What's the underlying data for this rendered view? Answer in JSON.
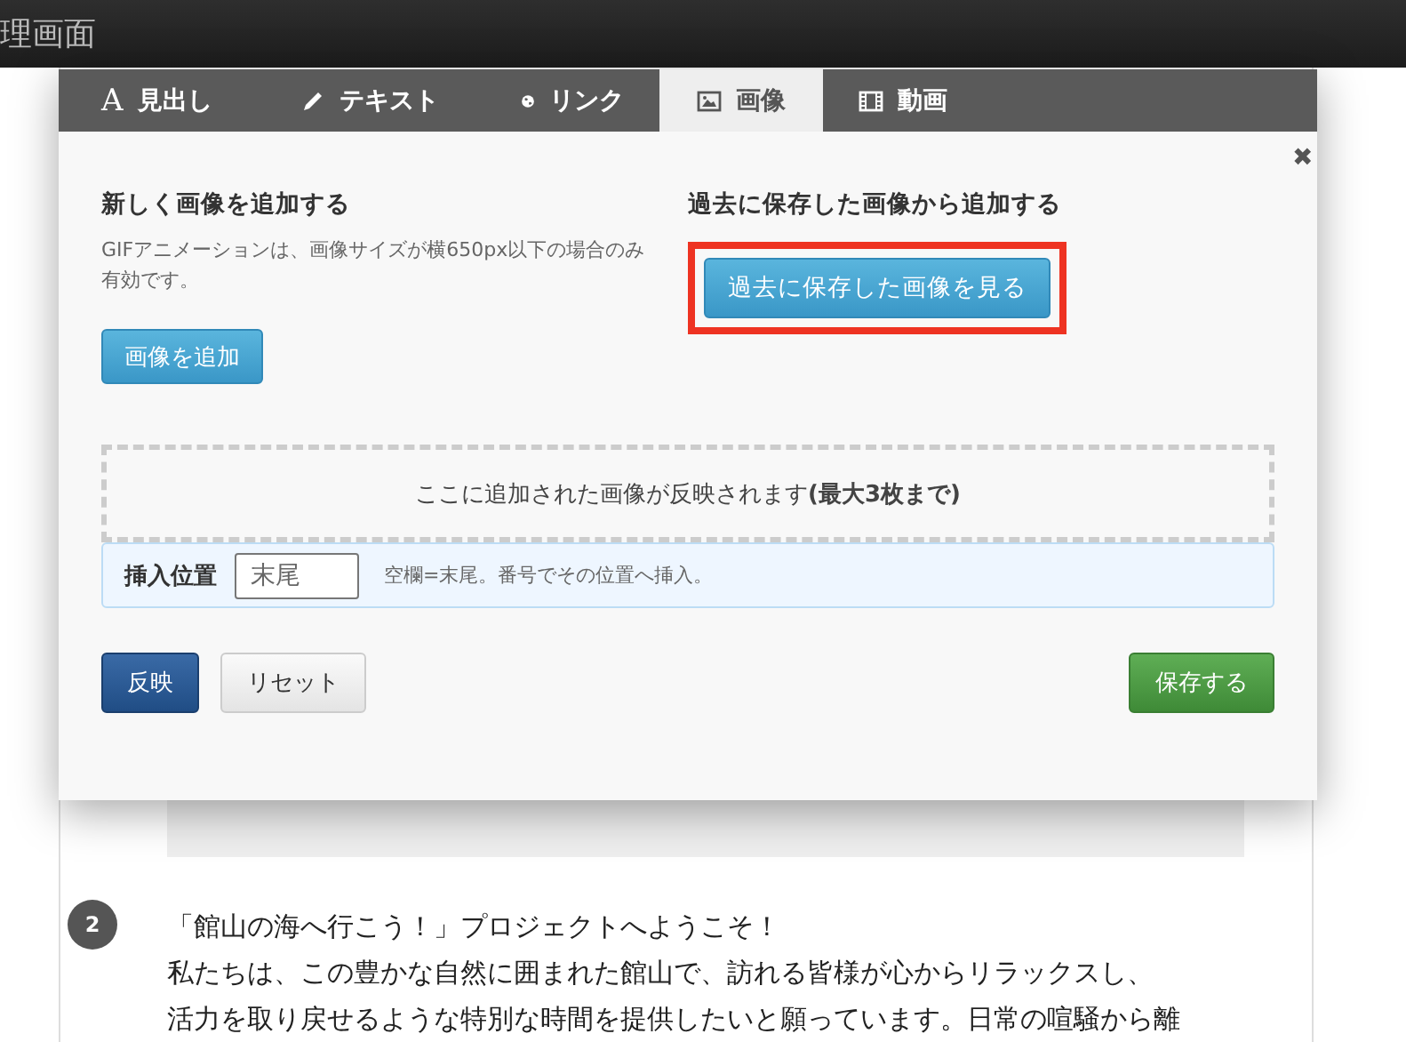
{
  "top_bar": {
    "title": "理画面"
  },
  "dialog": {
    "tabs": [
      {
        "label": "見出し",
        "kind": "letter",
        "glyph": "A",
        "selected": false
      },
      {
        "label": "テキスト",
        "kind": "pencil",
        "selected": false
      },
      {
        "label": "リンク",
        "kind": "globe",
        "selected": false
      },
      {
        "label": "画像",
        "kind": "picture",
        "selected": true
      },
      {
        "label": "動画",
        "kind": "film",
        "selected": false
      }
    ],
    "close": "✖",
    "new_image": {
      "heading": "新しく画像を追加する",
      "note": "GIFアニメーションは、画像サイズが横650px以下の場合のみ有効です。",
      "button": "画像を追加"
    },
    "saved_image": {
      "heading": "過去に保存した画像から追加する",
      "button": "過去に保存した画像を見る",
      "highlighted": true
    },
    "drop_area": {
      "text": "ここに追加された画像が反映されます**(最大3枚まで)**"
    },
    "insert_position": {
      "label": "挿入位置",
      "placeholder": "末尾",
      "hint": "空欄=末尾。番号でその位置へ挿入。"
    },
    "buttons": {
      "apply": "反映",
      "reset": "リセット",
      "save": "保存する"
    }
  },
  "page": {
    "step": "2",
    "paragraph_lines": [
      "「館山の海へ行こう！」プロジェクトへようこそ！",
      "私たちは、この豊かな自然に囲まれた館山で、訪れる皆様が心からリラックスし、",
      "活力を取り戻せるような特別な時間を提供したいと願っています。日常の喧騒から離"
    ]
  }
}
